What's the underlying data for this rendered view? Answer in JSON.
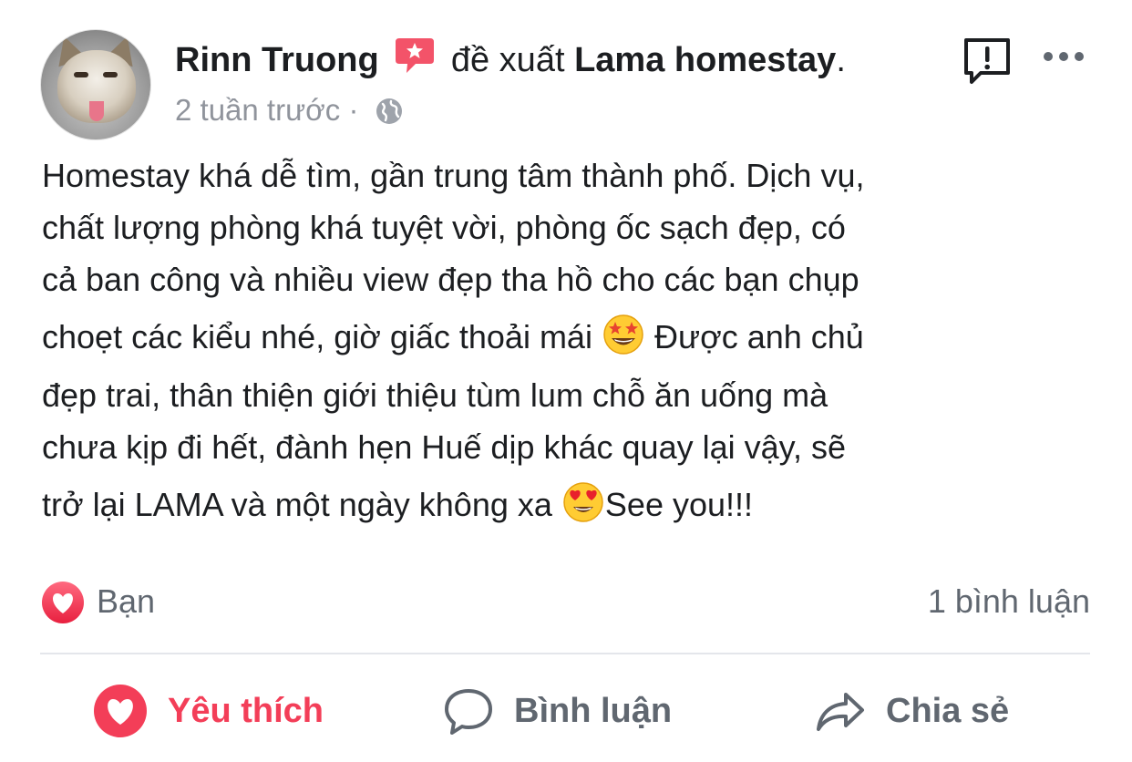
{
  "post": {
    "author": "Rinn Truong",
    "verb": "đề xuất",
    "page": "Lama homestay",
    "page_suffix": ".",
    "time": "2 tuần trước",
    "separator": "·",
    "lines": {
      "l1": "Homestay khá dễ tìm, gần trung tâm thành phố. Dịch vụ,",
      "l2": "chất lượng phòng khá tuyệt vời, phòng ốc sạch đẹp, có",
      "l3": "cả ban công và nhiều view đẹp tha hồ cho các bạn chụp",
      "l4a": "choẹt các kiểu nhé, giờ giấc thoải mái",
      "l4b": "Được anh chủ",
      "l5": "đẹp trai, thân thiện giới thiệu tùm lum chỗ ăn uống mà",
      "l6": "chưa kịp đi hết, đành hẹn Huế dịp khác quay lại vậy, sẽ",
      "l7a": "trở lại LAMA và một ngày không xa",
      "l7b": "See you!!!"
    }
  },
  "stats": {
    "reaction_label": "Bạn",
    "comment_count": "1 bình luận"
  },
  "actions": {
    "like": "Yêu thích",
    "comment": "Bình luận",
    "share": "Chia sẻ"
  },
  "icons": {
    "recommend": "recommend-icon",
    "globe": "globe-icon",
    "report": "report-icon",
    "more": "more-icon",
    "heart": "heart-icon",
    "emoji_star_struck": "star-struck-emoji",
    "emoji_heart_eyes": "heart-eyes-emoji"
  },
  "colors": {
    "accent_red": "#f33e58",
    "text": "#1c1e21",
    "muted": "#90949c",
    "action_gray": "#606770"
  }
}
